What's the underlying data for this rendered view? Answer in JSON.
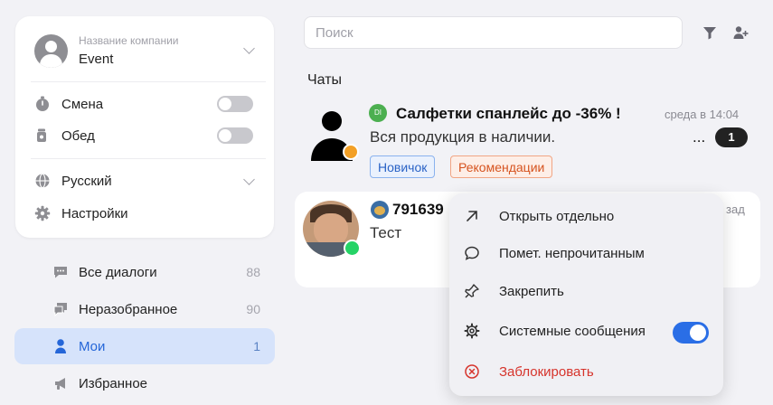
{
  "company": {
    "label": "Название компании",
    "name": "Event"
  },
  "settings": {
    "shift_label": "Смена",
    "shift_on": false,
    "lunch_label": "Обед",
    "lunch_on": false,
    "language": "Русский",
    "settings_label": "Настройки"
  },
  "nav": [
    {
      "label": "Все диалоги",
      "count": "88",
      "icon": "chat-bubble-icon"
    },
    {
      "label": "Неразобранное",
      "count": "90",
      "icon": "chat-bubbles-icon"
    },
    {
      "label": "Мои",
      "count": "1",
      "icon": "user-icon",
      "active": true
    },
    {
      "label": "Избранное",
      "count": "",
      "icon": "megaphone-icon"
    }
  ],
  "search": {
    "placeholder": "Поиск"
  },
  "chats_title": "Чаты",
  "chats": [
    {
      "source_badge": "DI",
      "title": "Салфетки спанлейс до -36% !",
      "time": "среда в 14:04",
      "preview": "Вся продукция в наличии.",
      "more": "...",
      "unread": "1",
      "tags": [
        "Новичок",
        "Рекомендации"
      ]
    },
    {
      "title": "791639",
      "time": "зад",
      "preview": "Тест"
    }
  ],
  "context_menu": {
    "items": [
      {
        "label": "Открыть отдельно",
        "icon": "arrow-up-right-icon"
      },
      {
        "label": "Помет. непрочитанным",
        "icon": "chat-outline-icon"
      },
      {
        "label": "Закрепить",
        "icon": "pin-icon"
      },
      {
        "label": "Системные сообщения",
        "icon": "gear-icon",
        "toggle_on": true
      },
      {
        "label": "Заблокировать",
        "icon": "block-icon",
        "danger": true
      }
    ]
  },
  "colors": {
    "accent": "#2a6ee6",
    "danger": "#d6342c",
    "active_nav_bg": "#d6e3fb",
    "tag_blue": "#2a63c6",
    "tag_red": "#d6531f",
    "whatsapp": "#25d366"
  }
}
